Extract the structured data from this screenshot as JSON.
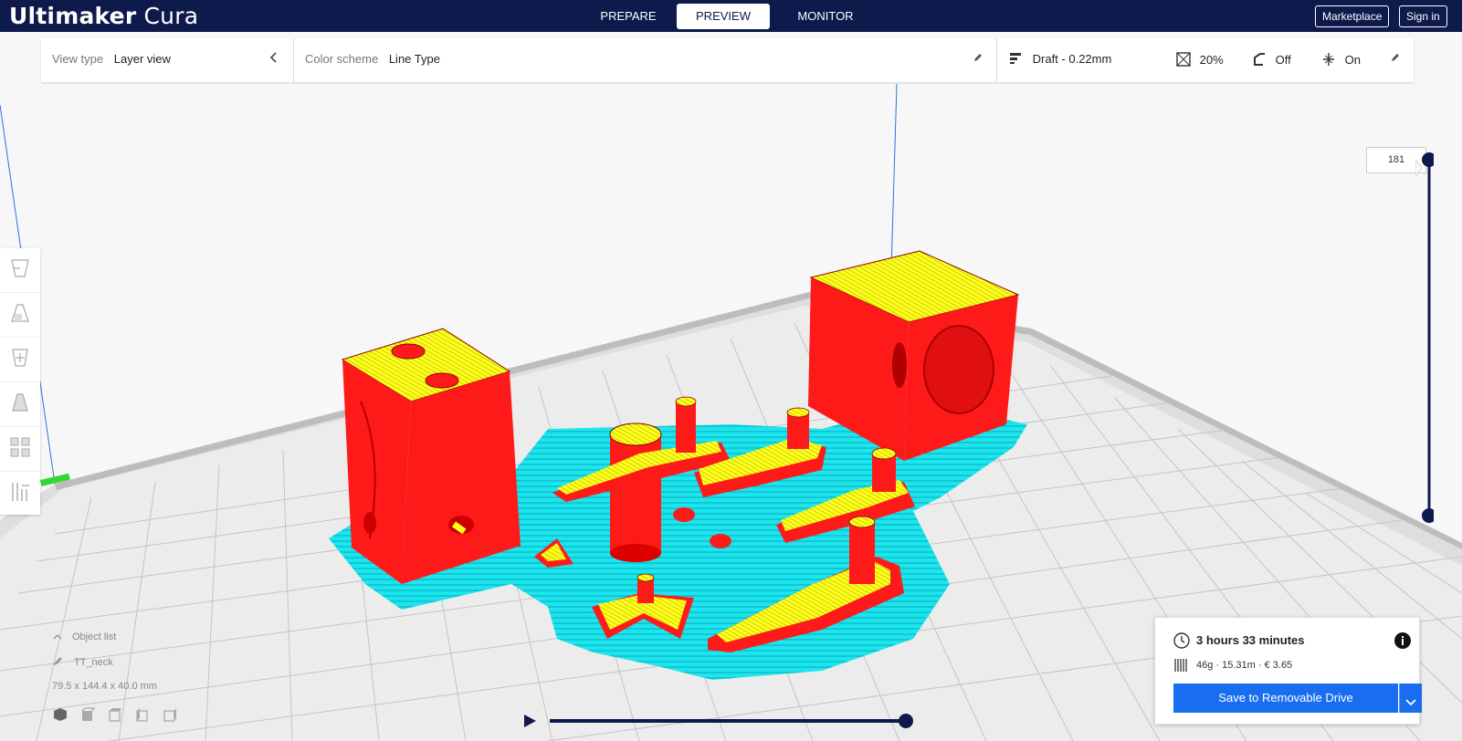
{
  "app": {
    "title_bold": "Ultimaker",
    "title_light": "Cura"
  },
  "stages": [
    {
      "label": "PREPARE",
      "active": false
    },
    {
      "label": "PREVIEW",
      "active": true
    },
    {
      "label": "MONITOR",
      "active": false
    }
  ],
  "header_buttons": {
    "marketplace": "Marketplace",
    "signin": "Sign in"
  },
  "toolbar": {
    "view_type_label": "View type",
    "view_type_value": "Layer view",
    "color_scheme_label": "Color scheme",
    "color_scheme_value": "Line Type",
    "profile": "Draft - 0.22mm",
    "infill": "20%",
    "support": "Off",
    "adhesion": "On"
  },
  "layer_slider": {
    "value": "181"
  },
  "object_list": {
    "label": "Object list",
    "object_name": "TT_neck",
    "dimensions": "79.5 x 144.4 x 40.0 mm"
  },
  "print_info": {
    "time": "3 hours 33 minutes",
    "material": "46g · 15.31m · € 3.65",
    "save_label": "Save to Removable Drive"
  },
  "colors": {
    "header": "#0e1a4b",
    "accent": "#196ef0",
    "wall": "#ff1a1a",
    "skin": "#ffff1a",
    "adhesion": "#1ae6f0",
    "build_plate": "#dedede",
    "grid": "#c4c4c4"
  },
  "icons": {
    "view_back": "chevron-left-icon",
    "edit": "pencil-icon",
    "profile": "profile-bars-icon",
    "infill": "infill-icon",
    "support": "support-icon",
    "adhesion": "adhesion-icon",
    "clock": "clock-icon",
    "material": "spool-icon",
    "info": "info-icon",
    "play": "play-icon"
  }
}
